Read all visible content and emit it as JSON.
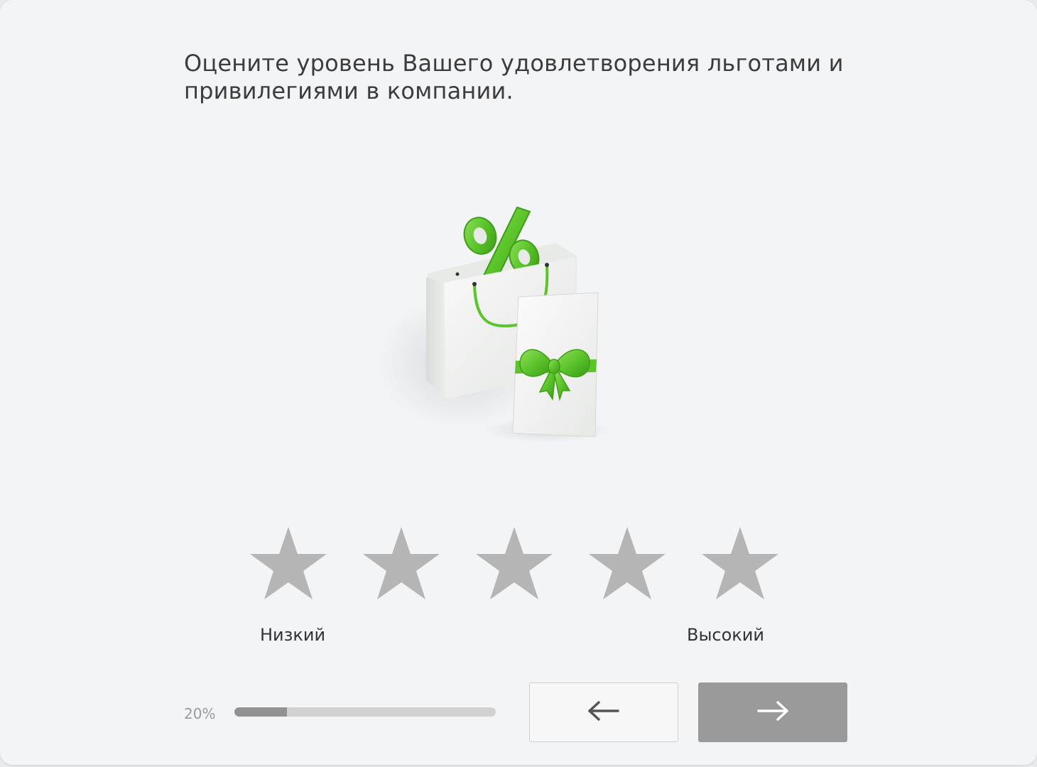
{
  "question": {
    "text": "Оцените уровень Вашего удовлетворения льготами и привилегиями в компании."
  },
  "illustration": {
    "icon": "shopping-bag-percent-gift-card-icon",
    "accent_color": "#5cc42b"
  },
  "rating": {
    "stars": [
      {
        "value": 1,
        "icon": "star-icon"
      },
      {
        "value": 2,
        "icon": "star-icon"
      },
      {
        "value": 3,
        "icon": "star-icon"
      },
      {
        "value": 4,
        "icon": "star-icon"
      },
      {
        "value": 5,
        "icon": "star-icon"
      }
    ],
    "selected": 0,
    "max": 5,
    "star_color": "#b5b5b5",
    "low_label": "Низкий",
    "high_label": "Высокий"
  },
  "progress": {
    "label": "20%",
    "value": 0.2
  },
  "navigation": {
    "back_icon": "arrow-left-icon",
    "next_icon": "arrow-right-icon"
  },
  "colors": {
    "background": "#f3f4f6",
    "text": "#3c3c3c",
    "next_button": "#9a9a9a"
  }
}
